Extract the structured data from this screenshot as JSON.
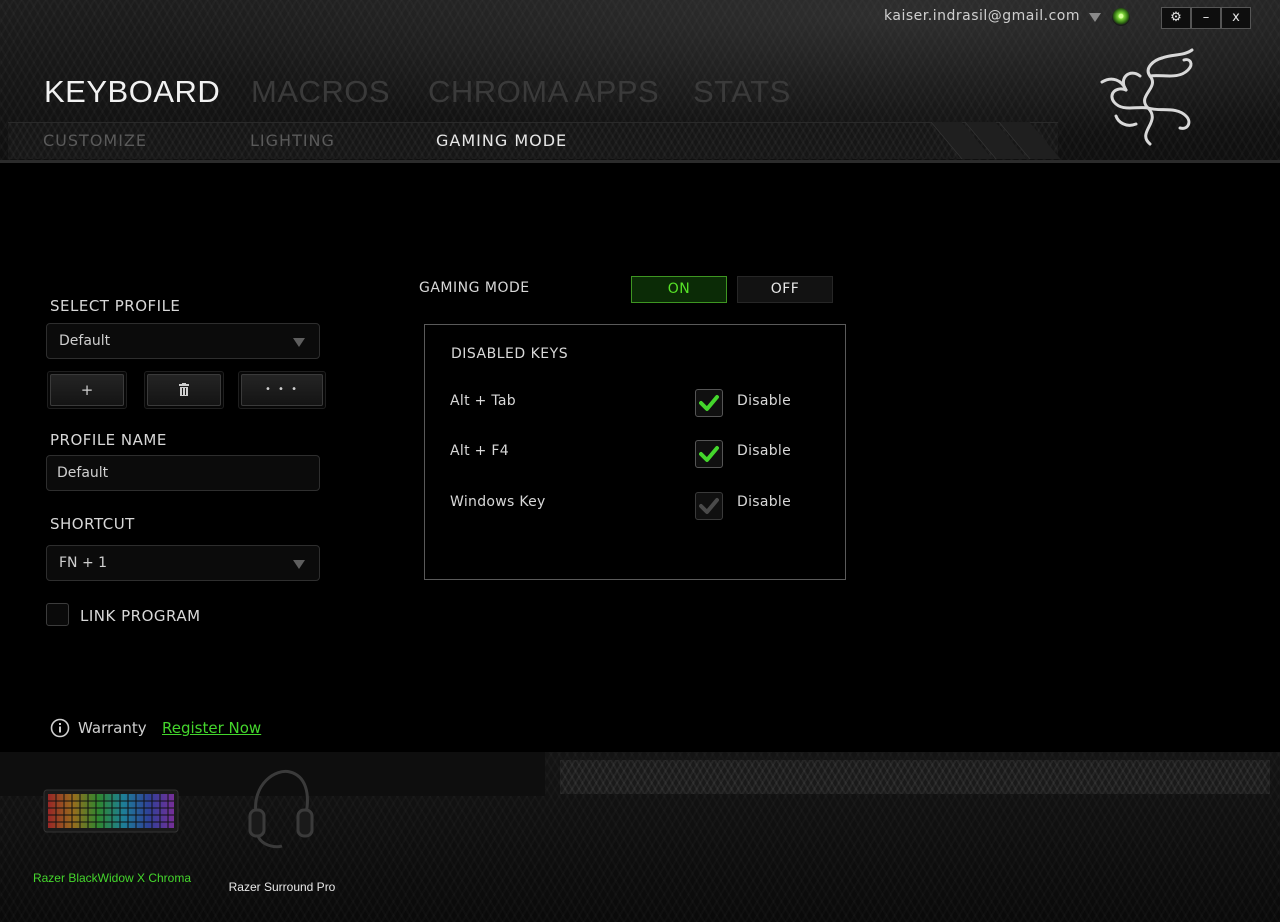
{
  "account": {
    "email": "kaiser.indrasil@gmail.com"
  },
  "window_controls": {
    "settings": "⚙",
    "minimize": "–",
    "close": "x"
  },
  "main_tabs": [
    {
      "label": "KEYBOARD",
      "active": true
    },
    {
      "label": "MACROS",
      "active": false
    },
    {
      "label": "CHROMA APPS",
      "active": false
    },
    {
      "label": "STATS",
      "active": false
    }
  ],
  "sub_tabs": [
    {
      "label": "CUSTOMIZE",
      "active": false
    },
    {
      "label": "LIGHTING",
      "active": false
    },
    {
      "label": "GAMING MODE",
      "active": true
    }
  ],
  "profile": {
    "select_label": "SELECT PROFILE",
    "selected": "Default",
    "buttons": {
      "add": "+",
      "delete": "🗑",
      "more": "• • •"
    },
    "name_label": "PROFILE NAME",
    "name_value": "Default",
    "shortcut_label": "SHORTCUT",
    "shortcut_value": "FN + 1",
    "link_program_label": "LINK PROGRAM",
    "link_program_checked": false
  },
  "gaming_mode": {
    "label": "GAMING MODE",
    "on_label": "ON",
    "off_label": "OFF",
    "state": "on",
    "disabled_keys_title": "DISABLED KEYS",
    "keys": [
      {
        "name": "Alt + Tab",
        "action": "Disable",
        "checked": true
      },
      {
        "name": "Alt + F4",
        "action": "Disable",
        "checked": true
      },
      {
        "name": "Windows Key",
        "action": "Disable",
        "checked": false
      }
    ]
  },
  "warranty": {
    "label": "Warranty",
    "link": "Register Now"
  },
  "devices": [
    {
      "name": "Razer BlackWidow X Chroma",
      "active": true,
      "icon": "keyboard-icon"
    },
    {
      "name": "Razer Surround Pro",
      "active": false,
      "icon": "headset-icon"
    }
  ],
  "colors": {
    "accent": "#44d62c",
    "accent_dark": "#0b2b06"
  }
}
